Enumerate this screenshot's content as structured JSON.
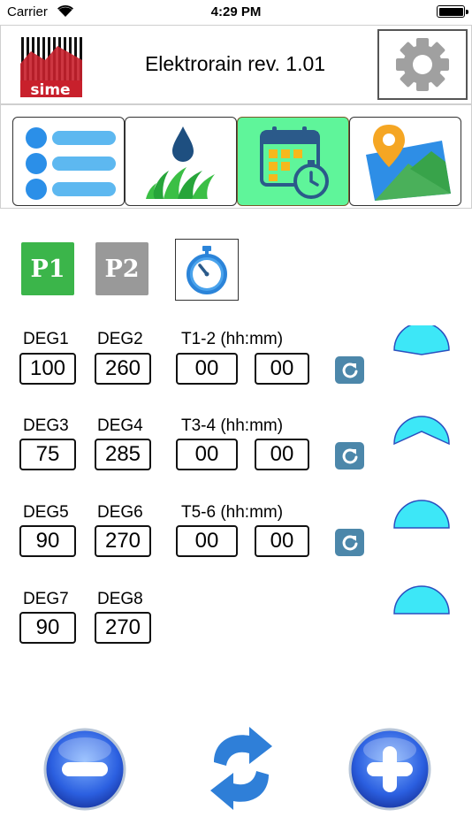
{
  "status": {
    "carrier": "Carrier",
    "time": "4:29 PM"
  },
  "header": {
    "title": "Elektrorain rev. 1.01",
    "logo_text": "sime"
  },
  "tabs": [
    {
      "icon": "list-icon",
      "active": false
    },
    {
      "icon": "irrigation-icon",
      "active": false
    },
    {
      "icon": "calendar-timer-icon",
      "active": true
    },
    {
      "icon": "map-icon",
      "active": false
    }
  ],
  "programs": {
    "p1": "P1",
    "p2": "P2",
    "active": "P1"
  },
  "rows": [
    {
      "deg_a_label": "DEG1",
      "deg_a": "100",
      "deg_b_label": "DEG2",
      "deg_b": "260",
      "time_label": "T1-2 (hh:mm)",
      "hh": "00",
      "mm": "00"
    },
    {
      "deg_a_label": "DEG3",
      "deg_a": "75",
      "deg_b_label": "DEG4",
      "deg_b": "285",
      "time_label": "T3-4 (hh:mm)",
      "hh": "00",
      "mm": "00"
    },
    {
      "deg_a_label": "DEG5",
      "deg_a": "90",
      "deg_b_label": "DEG6",
      "deg_b": "270",
      "time_label": "T5-6 (hh:mm)",
      "hh": "00",
      "mm": "00"
    },
    {
      "deg_a_label": "DEG7",
      "deg_a": "90",
      "deg_b_label": "DEG8",
      "deg_b": "270"
    }
  ],
  "colors": {
    "active_program": "#3bb54a",
    "inactive_program": "#999999",
    "active_tab": "#5ff59a",
    "dome": "#3de7f7",
    "refresh": "#4c87aa"
  }
}
